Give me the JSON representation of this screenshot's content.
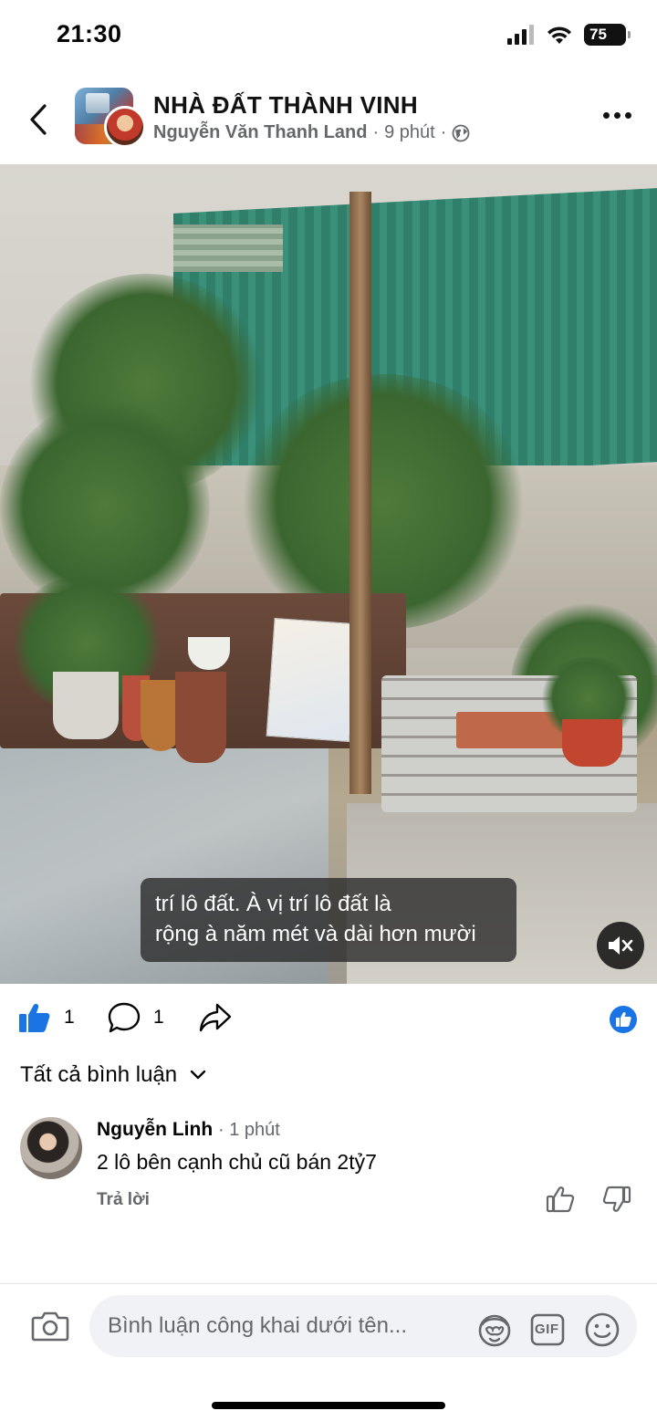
{
  "status_bar": {
    "time": "21:30",
    "battery": "75"
  },
  "header": {
    "group_name": "NHÀ ĐẤT THÀNH VINH",
    "author": "Nguyễn Văn Thanh Land",
    "separator": "·",
    "time_ago": "9 phút",
    "privacy_icon": "globe-icon"
  },
  "video": {
    "caption_line1": "trí lô đất. À vị trí lô đất là",
    "caption_line2": "rộng à năm mét và dài hơn mười",
    "muted": true
  },
  "actions": {
    "like_count": "1",
    "comment_count": "1"
  },
  "comments": {
    "header": "Tất cả bình luận",
    "items": [
      {
        "author": "Nguyễn Linh",
        "time_ago": "· 1 phút",
        "text": "2 lô bên cạnh chủ cũ bán 2tỷ7",
        "reply_label": "Trả lời"
      }
    ]
  },
  "composer": {
    "placeholder": "Bình luận công khai dưới tên...",
    "gif_label": "GIF"
  },
  "colors": {
    "accent": "#1b74e4",
    "meta_text": "#65676b",
    "input_bg": "#f0f2f5"
  }
}
